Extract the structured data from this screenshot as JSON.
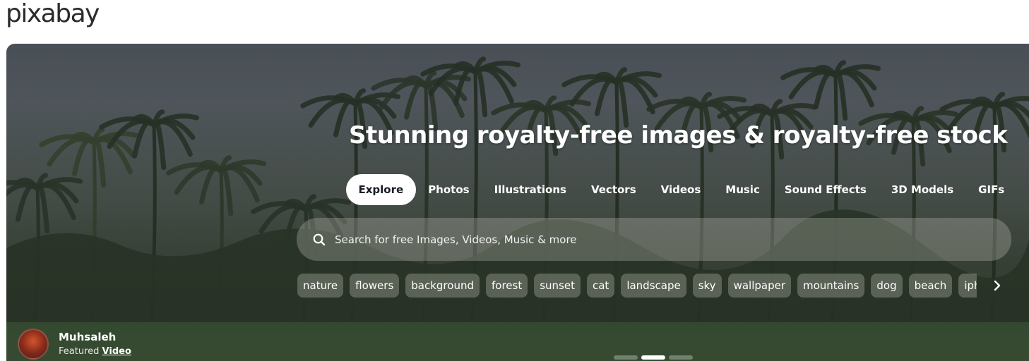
{
  "brand": {
    "logo_text": "pixabay"
  },
  "hero": {
    "headline": "Stunning royalty-free images & royalty-free stock",
    "tabs": [
      {
        "label": "Explore",
        "active": true
      },
      {
        "label": "Photos",
        "active": false
      },
      {
        "label": "Illustrations",
        "active": false
      },
      {
        "label": "Vectors",
        "active": false
      },
      {
        "label": "Videos",
        "active": false
      },
      {
        "label": "Music",
        "active": false
      },
      {
        "label": "Sound Effects",
        "active": false
      },
      {
        "label": "3D Models",
        "active": false
      },
      {
        "label": "GIFs",
        "active": false
      }
    ],
    "search": {
      "placeholder": "Search for free Images, Videos, Music & more",
      "value": ""
    },
    "chips": [
      "nature",
      "flowers",
      "background",
      "forest",
      "sunset",
      "cat",
      "landscape",
      "sky",
      "wallpaper",
      "mountains",
      "dog",
      "beach",
      "iph"
    ],
    "credit": {
      "author": "Muhsaleh",
      "featured_prefix": "Featured",
      "featured_link": "Video"
    },
    "carousel": {
      "count": 3,
      "active_index": 1
    }
  },
  "icons": {
    "search": "search-icon",
    "next": "chevron-right-icon",
    "avatar": "avatar"
  }
}
